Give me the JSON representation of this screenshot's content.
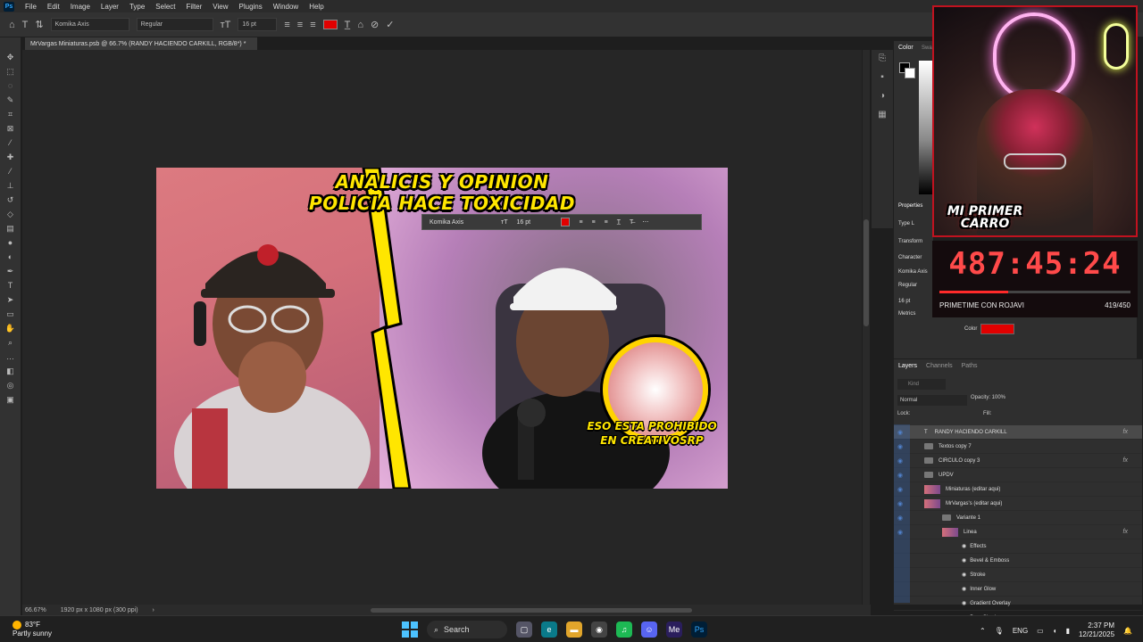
{
  "menubar": {
    "items": [
      "File",
      "Edit",
      "Image",
      "Layer",
      "Type",
      "Select",
      "Filter",
      "View",
      "Plugins",
      "Window",
      "Help"
    ]
  },
  "options_bar": {
    "font_family": "Komika Axis",
    "font_style": "Regular",
    "font_size": "16 pt",
    "text_color": "#e10000"
  },
  "document_tab": {
    "title": "MrVargas Miniaturas.psb @ 66.7% (RANDY HACIENDO CARKILL, RGB/8*) *"
  },
  "thumbnail": {
    "headline_1": "ANALICIS Y OPINION",
    "headline_2": "POLICIA HACE TOXICIDAD",
    "caption_1": "ESO ESTA PROHIBIDO",
    "caption_2": "EN CREATIVOSRP"
  },
  "floating_text_bar": {
    "font_family": "Komika Axis",
    "font_size": "16 pt"
  },
  "status_bar": {
    "zoom": "66.67%",
    "doc_info": "1920 px x 1080 px (300 ppi)"
  },
  "color_panel": {
    "tab_color": "Color",
    "tab_swatches": "Swa"
  },
  "properties_panel": {
    "title": "Properties",
    "type_label": "Type L",
    "transform_label": "Transform",
    "character_label": "Character",
    "font": "Komika Axis",
    "style": "Regular",
    "size": "16 pt",
    "metrics": "Metrics",
    "color_label": "Color",
    "color_value": "#e10000"
  },
  "webcam": {
    "logo_line1": "MI PRIMER",
    "logo_line2": "CARRO"
  },
  "timer": {
    "time": "487:45:24",
    "subtitle": "PRIMETIME CON ROJAVI",
    "count": "419/450",
    "progress": 0.36
  },
  "layers_panel": {
    "tabs": [
      "Layers",
      "Channels",
      "Paths"
    ],
    "search_placeholder": "Kind",
    "blend_mode": "Normal",
    "opacity": "Opacity: 100%",
    "lock": "Lock:",
    "fill": "Fill:",
    "layers": [
      {
        "name": "RANDY HACIENDO CARKILL",
        "kind": "text",
        "fx": "fx",
        "selected": true
      },
      {
        "name": "Textos copy 7",
        "kind": "folder",
        "fx": "",
        "selected": false
      },
      {
        "name": "CIRCULO copy 3",
        "kind": "folder",
        "fx": "fx",
        "selected": false
      },
      {
        "name": "UPDV",
        "kind": "folder",
        "fx": "",
        "selected": false
      },
      {
        "name": "Miniaturas (editar aqui)",
        "kind": "smart",
        "fx": "",
        "selected": false
      },
      {
        "name": "MrVargas's (editar aqui)",
        "kind": "smart",
        "fx": "",
        "selected": false
      },
      {
        "name": "Variante 1",
        "kind": "folder",
        "fx": "",
        "selected": false
      },
      {
        "name": "Linea",
        "kind": "layer",
        "fx": "fx",
        "selected": false
      },
      {
        "name": "Effects",
        "kind": "effect",
        "fx": "",
        "selected": false
      },
      {
        "name": "Bevel & Emboss",
        "kind": "effect",
        "fx": "",
        "selected": false
      },
      {
        "name": "Stroke",
        "kind": "effect",
        "fx": "",
        "selected": false
      },
      {
        "name": "Inner Glow",
        "kind": "effect",
        "fx": "",
        "selected": false
      },
      {
        "name": "Gradient Overlay",
        "kind": "effect",
        "fx": "",
        "selected": false
      },
      {
        "name": "Drop Shadow",
        "kind": "effect",
        "fx": "",
        "selected": false
      }
    ]
  },
  "taskbar": {
    "temperature": "83°F",
    "weather": "Partly sunny",
    "search_label": "Search",
    "language": "ENG",
    "time": "2:37 PM",
    "date": "12/21/2025"
  }
}
